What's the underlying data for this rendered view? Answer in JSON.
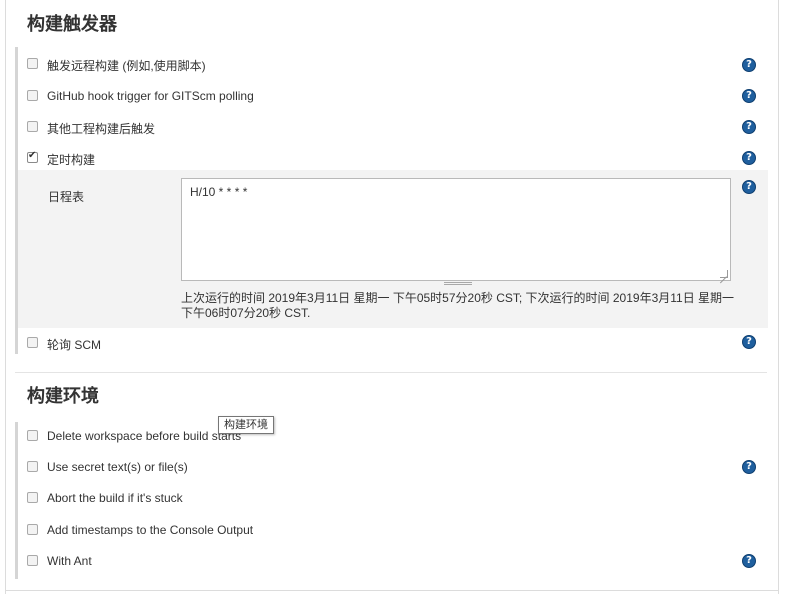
{
  "sections": {
    "build_triggers": {
      "title": "构建触发器",
      "rows": [
        {
          "label": "触发远程构建 (例如,使用脚本)",
          "checked": false,
          "help_icon": "question-circle"
        },
        {
          "label": "GitHub hook trigger for GITScm polling",
          "checked": false,
          "help_icon": "question-circle"
        },
        {
          "label": "其他工程构建后触发",
          "checked": false,
          "help_icon": "question-circle"
        },
        {
          "label": "定时构建",
          "checked": true,
          "help_icon": "question-circle"
        },
        {
          "label": "轮询 SCM",
          "checked": false,
          "help_icon": "question-circle"
        }
      ],
      "schedule": {
        "label": "日程表",
        "value": "H/10 * * * *",
        "info": "上次运行的时间 2019年3月11日 星期一 下午05时57分20秒 CST; 下次运行的时间 2019年3月11日 星期一 下午06时07分20秒 CST."
      }
    },
    "build_environment": {
      "title": "构建环境",
      "tooltip": "构建环境",
      "rows": [
        {
          "label": "Delete workspace before build starts",
          "checked": false
        },
        {
          "label": "Use secret text(s) or file(s)",
          "checked": false,
          "help_icon": "question-circle"
        },
        {
          "label": "Abort the build if it's stuck",
          "checked": false
        },
        {
          "label": "Add timestamps to the Console Output",
          "checked": false
        },
        {
          "label": "With Ant",
          "checked": false,
          "help_icon": "question-circle"
        }
      ]
    }
  },
  "help_glyph": "?",
  "colors": {
    "help_icon": "#1f5f9e",
    "panel_bg": "#f3f3f3",
    "left_bar": "#d5d5d5"
  }
}
